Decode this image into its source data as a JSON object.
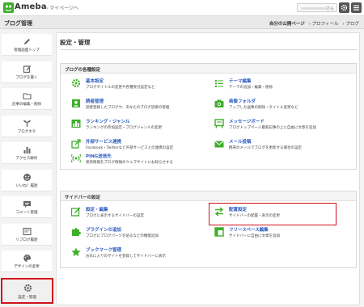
{
  "topbar": {
    "logo_text": "Ameba",
    "mypage_link": "› マイページへ",
    "user_suffix": "さん"
  },
  "subheader": {
    "title": "ブログ管理",
    "links": [
      "自分の公開ページ",
      "› プロフィール",
      "› ブログ"
    ]
  },
  "sidebar": {
    "items": [
      {
        "label": "管理画面トップ",
        "icon": "pencil-icon"
      },
      {
        "label": "ブログを書く",
        "icon": "edit-icon"
      },
      {
        "label": "記事の編集・削除",
        "icon": "folder-icon"
      },
      {
        "label": "ブログネタ",
        "icon": "sprout-icon"
      },
      {
        "label": "アクセス解析",
        "icon": "bar-chart-icon"
      },
      {
        "label": "いいね！履歴",
        "icon": "smile-icon"
      },
      {
        "label": "コメント管理",
        "icon": "comment-icon"
      },
      {
        "label": "リブログ履歴",
        "icon": "reblog-icon"
      },
      {
        "label": "デザインの変更",
        "icon": "palette-icon"
      },
      {
        "label": "設定・管理",
        "icon": "gear-icon",
        "active": true
      }
    ]
  },
  "main": {
    "title": "設定・管理",
    "blog_settings": {
      "heading": "ブログの各種設定",
      "entries": [
        {
          "title": "基本設定",
          "desc": "ブログタイトルの変更や各種受付設定など",
          "icon": "gear-icon"
        },
        {
          "title": "テーマ編集",
          "desc": "テーマの追加・編集・削除",
          "icon": "list-icon"
        },
        {
          "title": "読者管理",
          "desc": "読者登録したブログや、あなたのブログ読者の管理",
          "icon": "readers-icon"
        },
        {
          "title": "画像フォルダ",
          "desc": "アップした画像の削除・タイトル変更など",
          "icon": "camera-icon"
        },
        {
          "title": "ランキング・ジャンル",
          "desc": "ランキングの参加設定・ブログジャンルの変更",
          "icon": "ranking-icon"
        },
        {
          "title": "メッセージボード",
          "desc": "ブログトップページ最新記事の上に自由に文章を追加",
          "icon": "message-board-icon"
        },
        {
          "title": "外部サービス連携",
          "desc": "Facebook・Twitterなど外部サービスとの連携の設定",
          "icon": "share-icon"
        },
        {
          "title": "メール投稿",
          "desc": "携帯のメールでブログを更新する場合の設定",
          "icon": "mail-icon"
        },
        {
          "title": "PING送信先",
          "desc": "更新情報をブログ情報のウェブサイトにお知らせする",
          "icon": "ping-icon"
        }
      ]
    },
    "sidebar_settings": {
      "heading": "サイドバーの設定",
      "entries": [
        {
          "title": "設定・編集",
          "desc": "ブログに表示するサイドバーの設定",
          "icon": "sidebar-edit-icon"
        },
        {
          "title": "配置設定",
          "desc": "サイドバーの配置・表示の変更",
          "icon": "arrange-icon"
        },
        {
          "title": "プラグインの追加",
          "desc": "ブログにブログパーツを貼るなどの機能追加",
          "icon": "puzzle-icon"
        },
        {
          "title": "フリースペース編集",
          "desc": "サイドバーに自由に文章を追加",
          "icon": "free-space-icon"
        },
        {
          "title": "ブックマーク管理",
          "desc": "お気に入りのサイトを登録してサイドバーに表示",
          "icon": "star-icon"
        }
      ]
    }
  },
  "colors": {
    "accent_green": "#3fae2a",
    "link_blue": "#2a5bbf",
    "highlight_red": "#d0121b"
  }
}
